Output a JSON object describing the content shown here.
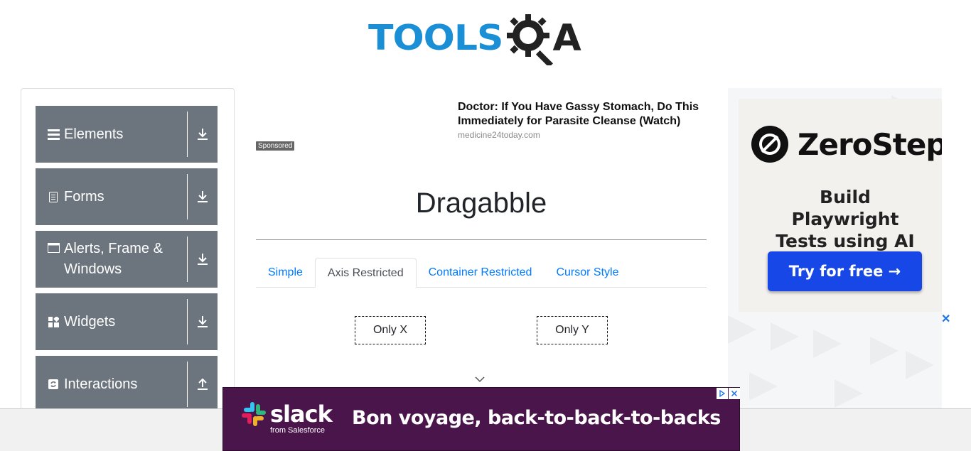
{
  "header": {
    "logo_text": "TOOLS",
    "logo_accent": "A"
  },
  "sidebar": {
    "groups": [
      {
        "label": "Elements",
        "icon": "list-icon",
        "toggle": "download-icon"
      },
      {
        "label": "Forms",
        "icon": "document-icon",
        "toggle": "download-icon"
      },
      {
        "label": "Alerts, Frame & Windows",
        "icon": "window-icon",
        "toggle": "download-icon"
      },
      {
        "label": "Widgets",
        "icon": "widgets-icon",
        "toggle": "download-icon"
      },
      {
        "label": "Interactions",
        "icon": "refresh-icon",
        "toggle": "upload-icon"
      }
    ]
  },
  "sponsored": {
    "badge": "Sponsored",
    "headline": "Doctor: If You Have Gassy Stomach, Do This Immediately for Parasite Cleanse (Watch)",
    "domain": "medicine24today.com"
  },
  "main": {
    "title": "Dragabble",
    "tabs": [
      {
        "label": "Simple",
        "active": false
      },
      {
        "label": "Axis Restricted",
        "active": true
      },
      {
        "label": "Container Restricted",
        "active": false
      },
      {
        "label": "Cursor Style",
        "active": false
      }
    ],
    "only_x": "Only X",
    "only_y": "Only Y"
  },
  "right_ad": {
    "brand": "ZeroStep",
    "subtitle": "Build Playwright Tests using AI",
    "cta": "Try for free →",
    "close": "✕"
  },
  "bottom_ad": {
    "brand": "slack",
    "from": "from Salesforce",
    "headline": "Bon voyage, back-to-back-to-backs",
    "colors": {
      "bg": "#4a154b"
    }
  },
  "colors": {
    "accent": "#007bff",
    "sidebar_bg": "#6c757d",
    "logo_blue": "#1a8fd6"
  }
}
